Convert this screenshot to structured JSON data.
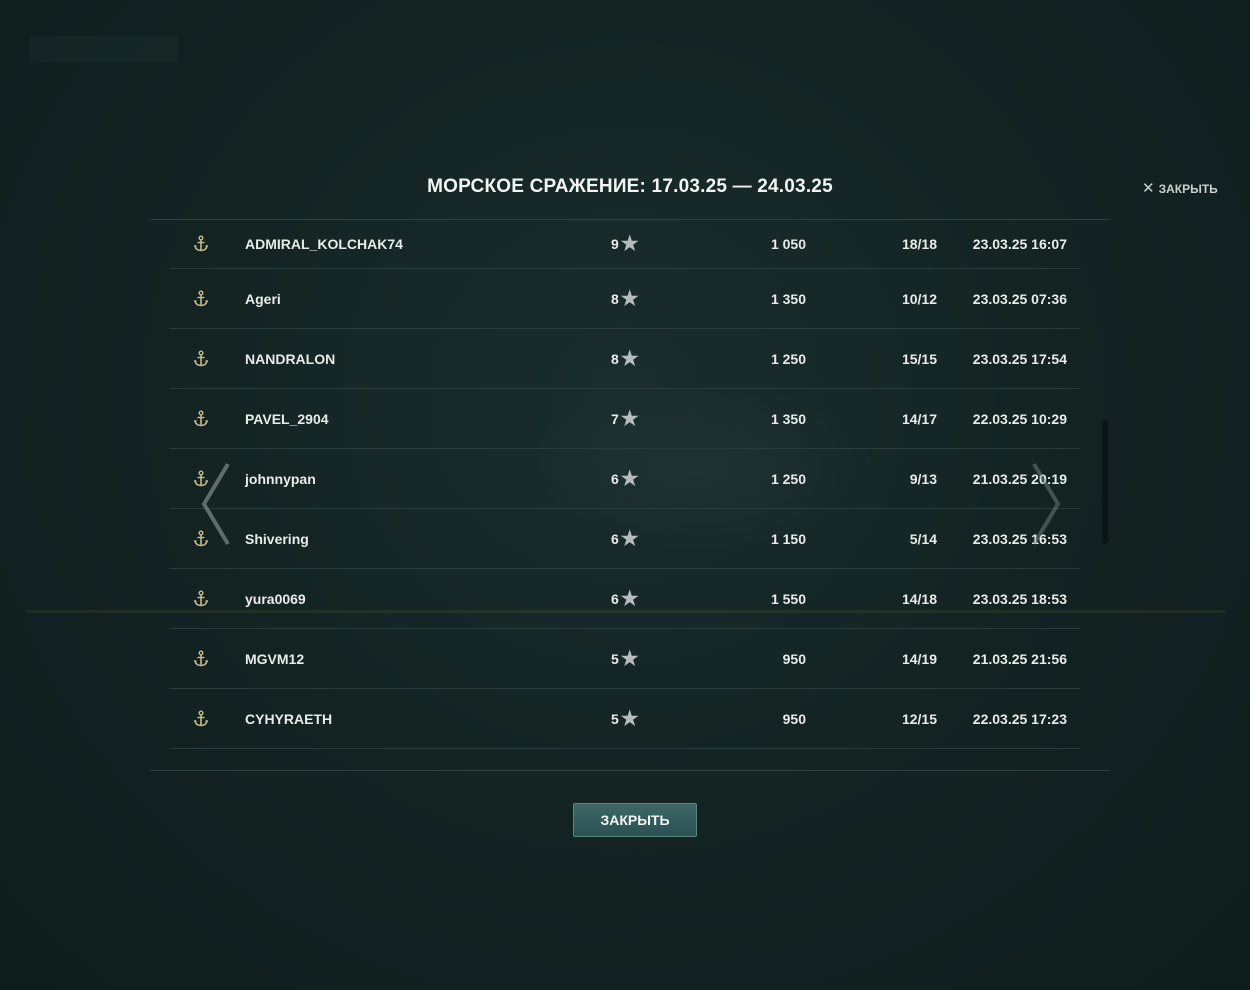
{
  "modal": {
    "title": "МОРСКОЕ СРАЖЕНИЕ: 17.03.25 — 24.03.25",
    "close_top_label": "ЗАКРЫТЬ",
    "close_button_label": "ЗАКРЫТЬ"
  },
  "rows": [
    {
      "name": "ADMIRAL_KOLCHAK74",
      "rank": "9",
      "score": "1 050",
      "battles": "18/18",
      "date": "23.03.25 16:07",
      "icon": "anchor-icon"
    },
    {
      "name": "Ageri",
      "rank": "8",
      "score": "1 350",
      "battles": "10/12",
      "date": "23.03.25 07:36",
      "icon": "anchor-icon"
    },
    {
      "name": "NANDRALON",
      "rank": "8",
      "score": "1 250",
      "battles": "15/15",
      "date": "23.03.25 17:54",
      "icon": "anchor-icon"
    },
    {
      "name": "PAVEL_2904",
      "rank": "7",
      "score": "1 350",
      "battles": "14/17",
      "date": "22.03.25 10:29",
      "icon": "anchor-icon"
    },
    {
      "name": "johnnypan",
      "rank": "6",
      "score": "1 250",
      "battles": "9/13",
      "date": "21.03.25 20:19",
      "icon": "anchor-icon"
    },
    {
      "name": "Shivering",
      "rank": "6",
      "score": "1 150",
      "battles": "5/14",
      "date": "23.03.25 16:53",
      "icon": "anchor-icon"
    },
    {
      "name": "yura0069",
      "rank": "6",
      "score": "1 550",
      "battles": "14/18",
      "date": "23.03.25 18:53",
      "icon": "anchor-icon"
    },
    {
      "name": "MGVM12",
      "rank": "5",
      "score": "950",
      "battles": "14/19",
      "date": "21.03.25 21:56",
      "icon": "anchor-icon"
    },
    {
      "name": "CYHYRAETH",
      "rank": "5",
      "score": "950",
      "battles": "12/15",
      "date": "22.03.25 17:23",
      "icon": "anchor-icon"
    }
  ],
  "colors": {
    "background": "#11201f",
    "button": "#2f5656",
    "text": "#e7ebe9",
    "anchor": "#c8b98a"
  }
}
